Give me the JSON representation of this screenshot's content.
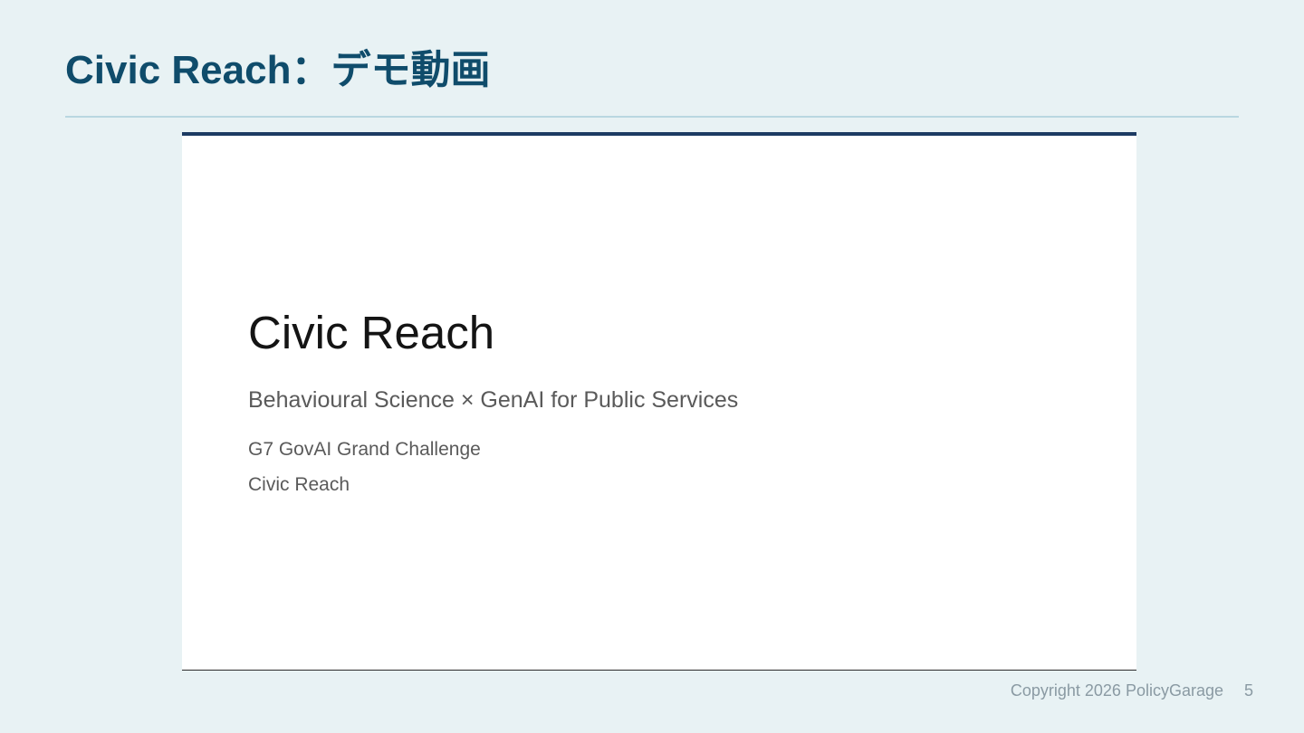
{
  "slide": {
    "title": "Civic Reach：デモ動画"
  },
  "video": {
    "title": "Civic Reach",
    "subtitle": "Behavioural Science × GenAI for Public Services",
    "event": "G7 GovAI Grand Challenge",
    "team": "Civic Reach"
  },
  "footer": {
    "copyright": "Copyright 2026 PolicyGarage",
    "page_number": "5"
  },
  "colors": {
    "background": "#e8f2f4",
    "title": "#0f4c6b",
    "rule": "#b9d7e1",
    "video_top_border": "#1d3b63",
    "footer_text": "#8a9aa3"
  }
}
